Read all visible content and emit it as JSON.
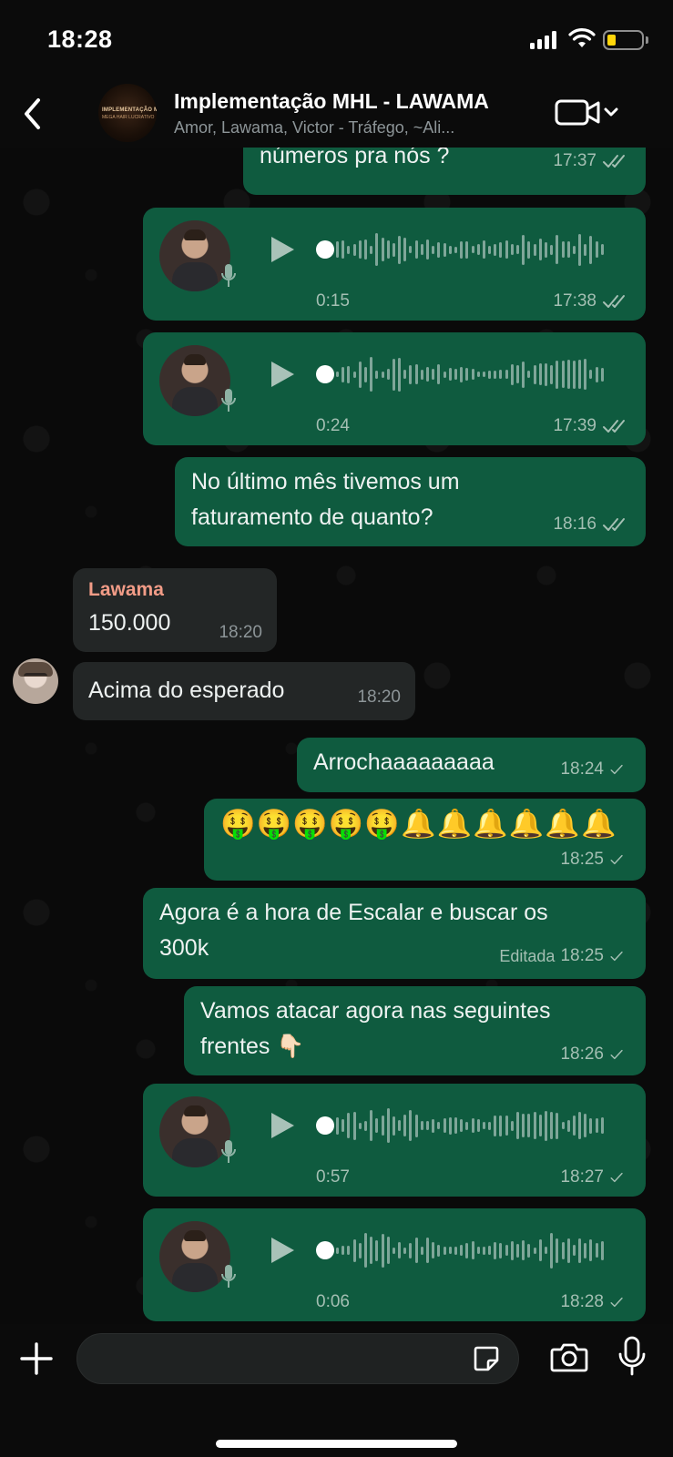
{
  "status_bar": {
    "time": "18:28",
    "battery_color": "#ffd60a"
  },
  "header": {
    "title": "Implementação MHL -  LAWAMA",
    "subtitle": "Amor, Lawama, Victor - Tráfego, ~Ali...",
    "avatar_text_line1": "IMPLEMENTAÇÃO MHL",
    "avatar_text_line2": "MEGA HAIR LUCRATIVO",
    "back_icon": "chevron-left-icon",
    "video_icon": "video-camera-icon"
  },
  "messages": [
    {
      "type": "text",
      "dir": "out",
      "text": "números pra nós ?",
      "time": "17:37",
      "status": "read"
    },
    {
      "type": "voice",
      "dir": "out",
      "duration": "0:15",
      "time": "17:38",
      "status": "read"
    },
    {
      "type": "voice",
      "dir": "out",
      "duration": "0:24",
      "time": "17:39",
      "status": "read"
    },
    {
      "type": "text",
      "dir": "out",
      "lines": [
        "No último mês tivemos um",
        "faturamento de quanto?"
      ],
      "time": "18:16",
      "status": "read"
    },
    {
      "type": "text",
      "dir": "in",
      "sender": "Lawama",
      "text": "150.000",
      "time": "18:20"
    },
    {
      "type": "text",
      "dir": "in",
      "text": "Acima do esperado",
      "time": "18:20"
    },
    {
      "type": "text",
      "dir": "out",
      "text": "Arrochaaaaaaaaa",
      "time": "18:24",
      "status": "sent"
    },
    {
      "type": "emoji",
      "dir": "out",
      "text": "🤑🤑🤑🤑🤑🔔🔔🔔🔔🔔🔔",
      "time": "18:25",
      "status": "sent"
    },
    {
      "type": "text",
      "dir": "out",
      "lines": [
        "Agora é a hora de Escalar e buscar os",
        "300k"
      ],
      "edited": "Editada",
      "time": "18:25",
      "status": "sent"
    },
    {
      "type": "text",
      "dir": "out",
      "lines": [
        "Vamos atacar agora nas seguintes",
        "frentes 👇🏻"
      ],
      "time": "18:26",
      "status": "sent"
    },
    {
      "type": "voice",
      "dir": "out",
      "duration": "0:57",
      "time": "18:27",
      "status": "sent"
    },
    {
      "type": "voice",
      "dir": "out",
      "duration": "0:06",
      "time": "18:28",
      "status": "sent"
    }
  ],
  "composer": {
    "placeholder": ""
  },
  "colors": {
    "outgoing_bubble": "#0f5b3f",
    "incoming_bubble": "#232626",
    "sender_name": "#f29c87",
    "waveform": "#7fa699"
  }
}
